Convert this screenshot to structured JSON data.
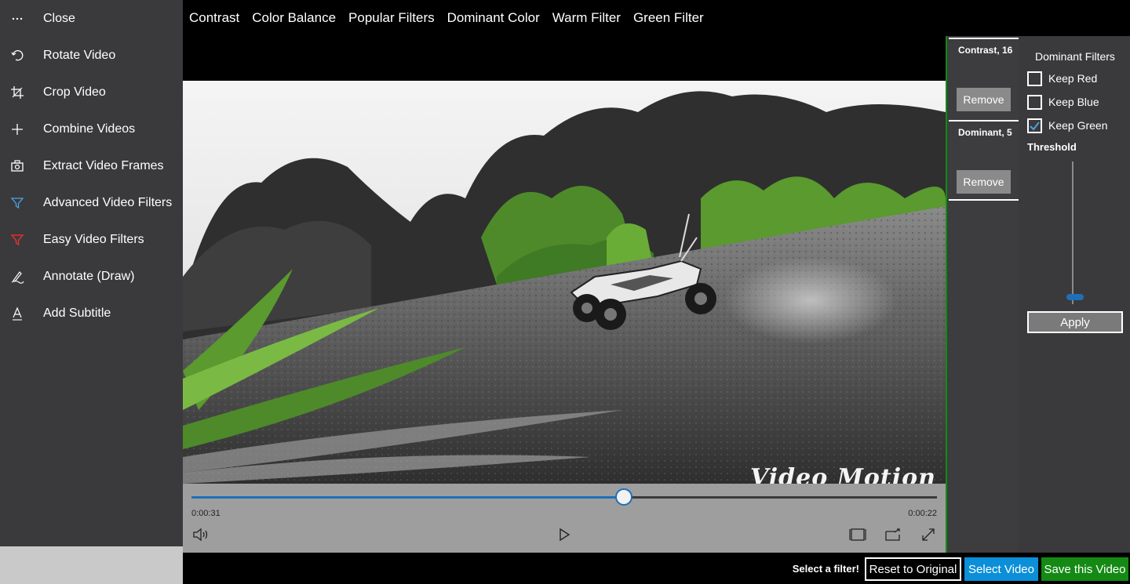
{
  "sidebar": {
    "items": [
      {
        "label": "Close",
        "icon": "more-icon"
      },
      {
        "label": "Rotate Video",
        "icon": "rotate-icon"
      },
      {
        "label": "Crop Video",
        "icon": "crop-icon"
      },
      {
        "label": "Combine Videos",
        "icon": "plus-icon"
      },
      {
        "label": "Extract Video Frames",
        "icon": "camera-icon"
      },
      {
        "label": "Advanced Video Filters",
        "icon": "filter-icon"
      },
      {
        "label": "Easy Video Filters",
        "icon": "filter-icon-active"
      },
      {
        "label": "Annotate (Draw)",
        "icon": "pen-icon"
      },
      {
        "label": "Add Subtitle",
        "icon": "text-icon"
      }
    ]
  },
  "tabs": [
    "Contrast",
    "Color Balance",
    "Popular Filters",
    "Dominant Color",
    "Warm Filter",
    "Green Filter"
  ],
  "player": {
    "watermark": "Video Motion",
    "time_elapsed": "0:00:31",
    "time_remaining": "0:00:22",
    "progress": 0.58
  },
  "applied_filters": [
    {
      "title": "Contrast, 16",
      "remove_label": "Remove"
    },
    {
      "title": "Dominant, 5",
      "remove_label": "Remove"
    }
  ],
  "panel": {
    "title": "Dominant Filters",
    "options": [
      {
        "label": "Keep Red",
        "checked": false
      },
      {
        "label": "Keep Blue",
        "checked": false
      },
      {
        "label": "Keep Green",
        "checked": true
      }
    ],
    "threshold_label": "Threshold",
    "threshold_value": 0.05,
    "apply_label": "Apply"
  },
  "bottom": {
    "hint": "Select a filter!",
    "reset_label": "Reset to Original",
    "select_label": "Select Video",
    "save_label": "Save this Video"
  },
  "colors": {
    "accent": "#1f6fb8",
    "select_button": "#0b8fd8",
    "save_button": "#148a14",
    "active_filter_icon": "#e03030"
  }
}
